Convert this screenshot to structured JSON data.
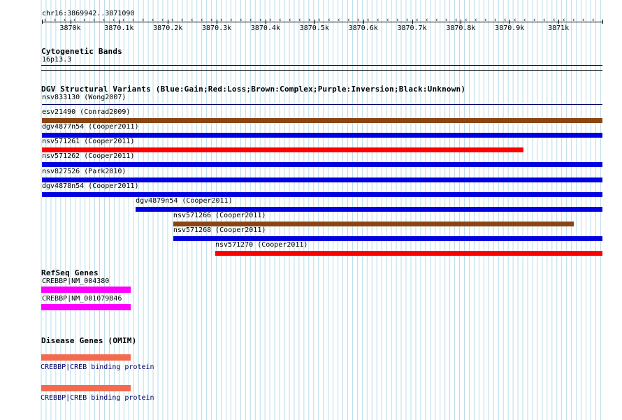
{
  "coordinate_title": "chr16:3869942..3871090",
  "ruler": {
    "start": 3869942,
    "end": 3871090,
    "ticks": [
      "3870k",
      "3870.1k",
      "3870.2k",
      "3870.3k",
      "3870.4k",
      "3870.5k",
      "3870.6k",
      "3870.7k",
      "3870.8k",
      "3870.9k",
      "3871k"
    ],
    "tick_values": [
      3870000,
      3870100,
      3870200,
      3870300,
      3870400,
      3870500,
      3870600,
      3870700,
      3870800,
      3870900,
      3871000
    ]
  },
  "cytoband": {
    "title": "Cytogenetic Bands",
    "band_label": "16p13.3"
  },
  "dgv": {
    "title": "DGV Structural Variants (Blue:Gain;Red:Loss;Brown:Complex;Purple:Inversion;Black:Unknown)",
    "colors": {
      "gain": "#0000e0",
      "loss": "#ff0000",
      "complex": "#8b4513",
      "unknown": "#000066"
    },
    "variants": [
      {
        "label": "nsv833130 (Wong2007)",
        "type": "unknown",
        "start": 3869942,
        "end": 3871090
      },
      {
        "label": "esv21490 (Conrad2009)",
        "type": "complex",
        "start": 3869942,
        "end": 3871090
      },
      {
        "label": "dgv4877n54 (Cooper2011)",
        "type": "gain",
        "start": 3869942,
        "end": 3871090
      },
      {
        "label": "nsv571261 (Cooper2011)",
        "type": "loss",
        "start": 3869942,
        "end": 3870928
      },
      {
        "label": "nsv571262 (Cooper2011)",
        "type": "gain",
        "start": 3869942,
        "end": 3871090
      },
      {
        "label": "nsv827526 (Park2010)",
        "type": "gain",
        "start": 3869942,
        "end": 3871090
      },
      {
        "label": "dgv4878n54 (Cooper2011)",
        "type": "gain",
        "start": 3869942,
        "end": 3871090
      },
      {
        "label": "dgv4879n54 (Cooper2011)",
        "type": "gain",
        "start": 3870134,
        "end": 3871090
      },
      {
        "label": "nsv571266 (Cooper2011)",
        "type": "complex",
        "start": 3870211,
        "end": 3871032
      },
      {
        "label": "nsv571268 (Cooper2011)",
        "type": "gain",
        "start": 3870211,
        "end": 3871090
      },
      {
        "label": "nsv571270 (Cooper2011)",
        "type": "loss",
        "start": 3870297,
        "end": 3871090
      }
    ]
  },
  "refseq": {
    "title": "RefSeq Genes",
    "color": "#ff00ff",
    "genes": [
      {
        "label": "CREBBP|NM_004380",
        "start": 3869942,
        "end": 3870125
      },
      {
        "label": "CREBBP|NM_001079846",
        "start": 3869942,
        "end": 3870125
      }
    ]
  },
  "omim": {
    "title": "Disease Genes (OMIM)",
    "color": "#f46a4e",
    "genes": [
      {
        "label": "CREBBP|CREB binding protein",
        "start": 3869942,
        "end": 3870125
      },
      {
        "label": "CREBBP|CREB binding protein",
        "start": 3869942,
        "end": 3870125
      }
    ]
  }
}
